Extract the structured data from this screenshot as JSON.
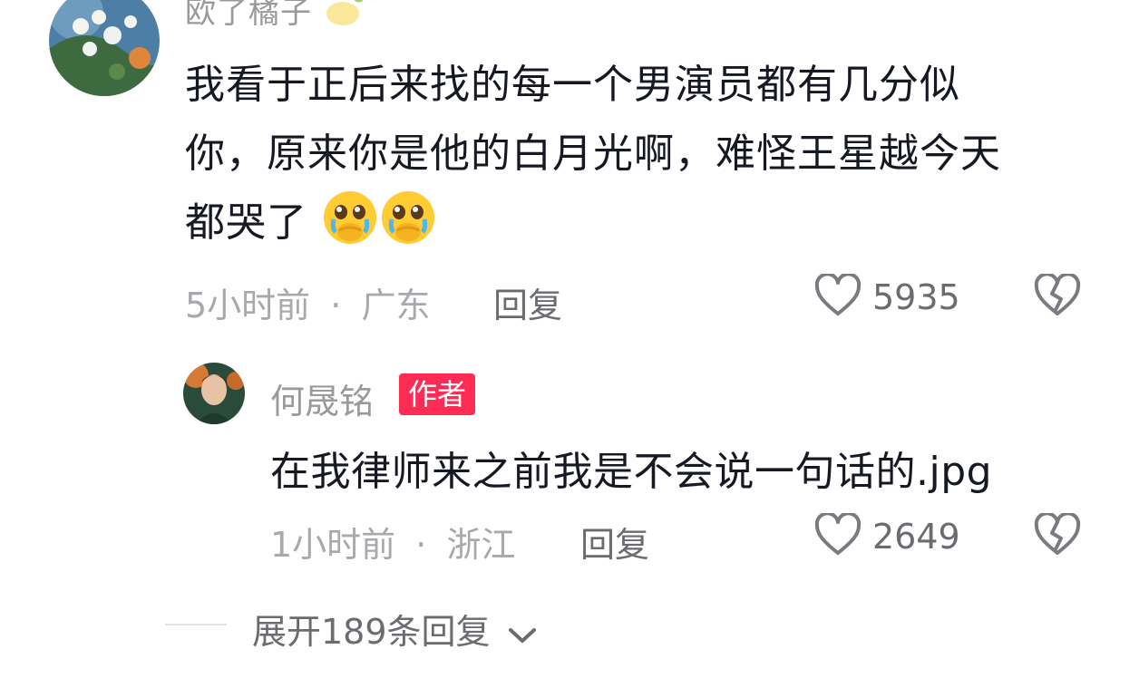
{
  "comment": {
    "username": "欧了橘子",
    "text_lines": [
      "我看于正后来找的每一个男演员都有几分似",
      "你，原来你是他的白月光啊，难怪王星越今天",
      "都哭了"
    ],
    "emoji_count": 2,
    "time": "5小时前",
    "location": "广东",
    "dot": "·",
    "reply_label": "回复",
    "likes": "5935"
  },
  "reply": {
    "username": "何晟铭",
    "badge": "作者",
    "text": "在我律师来之前我是不会说一句话的.jpg",
    "time": "1小时前",
    "location": "浙江",
    "dot": "·",
    "reply_label": "回复",
    "likes": "2649"
  },
  "expand": {
    "label": "展开189条回复"
  },
  "icons": {
    "like": "heart-outline-icon",
    "dislike": "broken-heart-icon",
    "expand": "chevron-down-icon",
    "emoji": "crying-face-emoji-icon",
    "lemon": "lemon-icon"
  },
  "colors": {
    "author_badge": "#fe2c55",
    "muted": "#a8a8ad",
    "text": "#161823"
  }
}
